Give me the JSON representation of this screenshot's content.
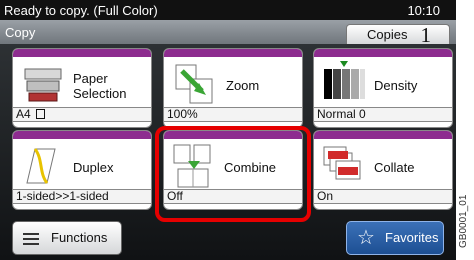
{
  "status": {
    "message": "Ready to copy. (Full Color)",
    "time": "10:10"
  },
  "header": {
    "title": "Copy",
    "copies_label": "Copies",
    "copies_value": "1"
  },
  "tiles": [
    {
      "label": "Paper\nSelection",
      "value": "A4"
    },
    {
      "label": "Zoom",
      "value": "100%"
    },
    {
      "label": "Density",
      "value": "Normal 0"
    },
    {
      "label": "Duplex",
      "value": "1-sided>>1-sided"
    },
    {
      "label": "Combine",
      "value": "Off"
    },
    {
      "label": "Collate",
      "value": "On"
    }
  ],
  "bottom": {
    "functions_label": "Functions",
    "favorites_label": "Favorites"
  },
  "side_id": "GB0001_01",
  "colors": {
    "accent_purple": "#8d2c8f",
    "highlight_red": "#e60000",
    "favorites_blue": "#2f65ad"
  }
}
